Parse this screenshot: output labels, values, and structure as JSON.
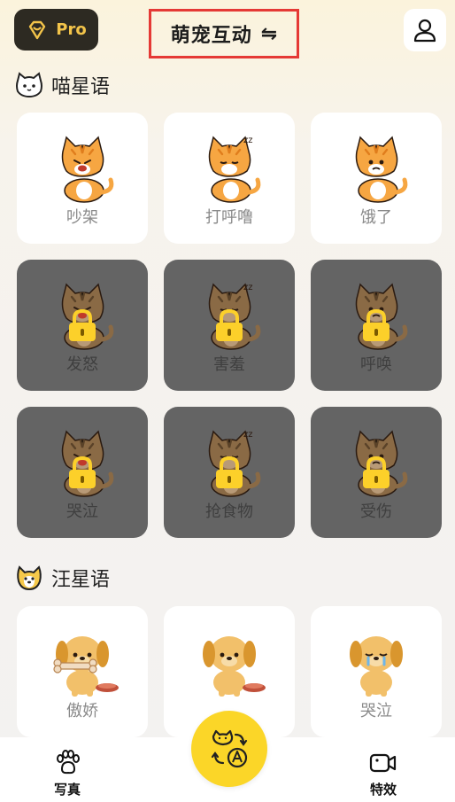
{
  "header": {
    "pro_label": "Pro",
    "title": "萌宠互动",
    "swap_symbol": "⇋"
  },
  "sections": [
    {
      "title": "喵星语",
      "icon": "cat-face-icon"
    },
    {
      "title": "汪星语",
      "icon": "dog-face-icon"
    }
  ],
  "cat_cards": [
    {
      "label": "吵架",
      "locked": false
    },
    {
      "label": "打呼噜",
      "locked": false
    },
    {
      "label": "饿了",
      "locked": false
    },
    {
      "label": "发怒",
      "locked": true
    },
    {
      "label": "害羞",
      "locked": true
    },
    {
      "label": "呼唤",
      "locked": true
    },
    {
      "label": "哭泣",
      "locked": true
    },
    {
      "label": "抢食物",
      "locked": true
    },
    {
      "label": "受伤",
      "locked": true
    }
  ],
  "dog_cards": [
    {
      "label": "傲娇",
      "locked": false
    },
    {
      "label": "",
      "locked": false
    },
    {
      "label": "哭泣",
      "locked": false
    }
  ],
  "bottom_nav": {
    "left_label": "写真",
    "right_label": "特效"
  },
  "colors": {
    "accent_yellow": "#fbd628",
    "pro_gold": "#f3c44a",
    "locked_card": "#646464",
    "highlight_box": "#e53935"
  }
}
